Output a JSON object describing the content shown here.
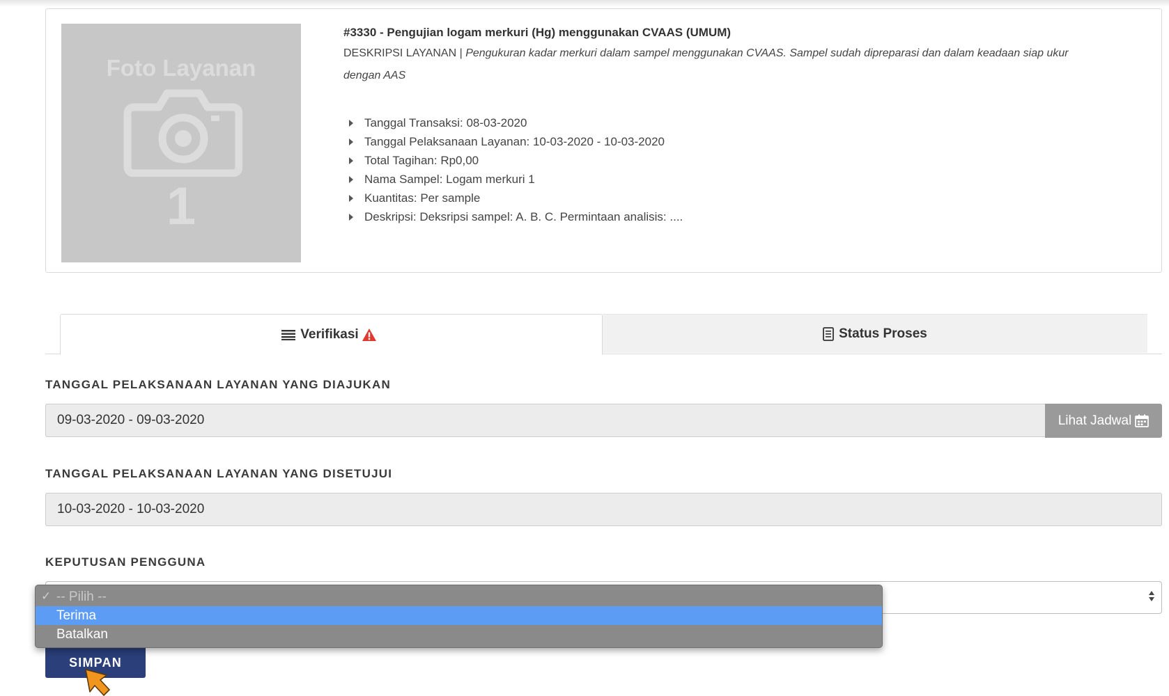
{
  "service": {
    "photo_text": "Foto Layanan",
    "photo_number": "1",
    "title": "#3330 - Pengujian logam merkuri (Hg) menggunakan CVAAS (UMUM)",
    "desc_label": "DESKRIPSI LAYANAN |",
    "desc_text": "Pengukuran kadar merkuri dalam sampel menggunakan CVAAS. Sampel sudah dipreparasi dan dalam keadaan siap ukur dengan AAS",
    "details": [
      "Tanggal Transaksi: 08-03-2020",
      "Tanggal Pelaksanaan Layanan: 10-03-2020 - 10-03-2020",
      "Total Tagihan: Rp0,00",
      "Nama Sampel: Logam merkuri 1",
      "Kuantitas: Per sample",
      "Deskripsi: Deksripsi sampel: A. B. C. Permintaan analisis: ...."
    ]
  },
  "tabs": [
    {
      "label": "Verifikasi",
      "active": true
    },
    {
      "label": "Status Proses",
      "active": false
    }
  ],
  "form": {
    "proposed_label": "TANGGAL PELAKSANAAN LAYANAN YANG DIAJUKAN",
    "proposed_value": "09-03-2020 - 09-03-2020",
    "lihat_jadwal": "Lihat Jadwal",
    "approved_label": "TANGGAL PELAKSANAAN LAYANAN YANG DISETUJUI",
    "approved_value": "10-03-2020 - 10-03-2020",
    "decision_label": "KEPUTUSAN PENGGUNA",
    "decision_options": [
      "-- Pilih --",
      "Terima",
      "Batalkan"
    ],
    "decision_highlighted": "Terima",
    "submit_label": "SIMPAN"
  },
  "colors": {
    "submit_bg": "#2b3f7a",
    "highlight": "#5c9cf5",
    "warning": "#e03a2f",
    "cursor": "#f0961e"
  }
}
